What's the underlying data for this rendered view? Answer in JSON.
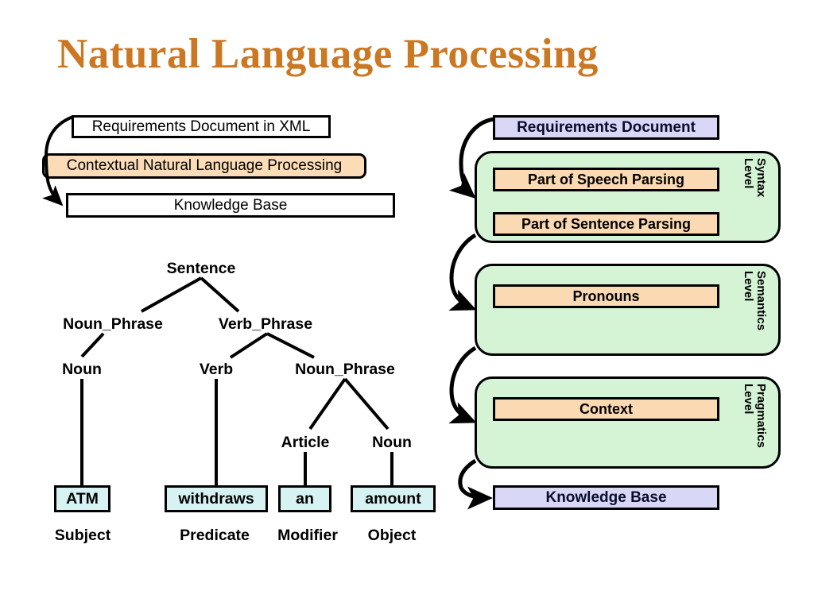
{
  "slide": {
    "title": "Natural Language Processing",
    "title_color": "#CC7722",
    "background": "#FFFFFF"
  },
  "left_flow": {
    "boxes": [
      {
        "label": "Requirements Document in XML",
        "fill": "#FFFFFF",
        "shape": "rect"
      },
      {
        "label": "Contextual Natural Language Processing",
        "fill": "#FBDCB6",
        "shape": "rounded"
      },
      {
        "label": "Knowledge Base",
        "fill": "#FFFFFF",
        "shape": "rect"
      }
    ]
  },
  "parse_tree": {
    "nodes": [
      {
        "label": "Sentence"
      },
      {
        "label": "Noun_Phrase"
      },
      {
        "label": "Verb_Phrase"
      },
      {
        "label": "Noun"
      },
      {
        "label": "Verb"
      },
      {
        "label": "Noun_Phrase"
      },
      {
        "label": "Article"
      },
      {
        "label": "Noun"
      }
    ],
    "leaves": [
      {
        "word": "ATM",
        "role": "Subject",
        "fill": "#D6F2F2"
      },
      {
        "word": "withdraws",
        "role": "Predicate",
        "fill": "#D6F2F2"
      },
      {
        "word": "an",
        "role": "Modifier",
        "fill": "#D6F2F2"
      },
      {
        "word": "amount",
        "role": "Object",
        "fill": "#D6F2F2"
      }
    ]
  },
  "pipeline": {
    "input": {
      "label": "Requirements Document",
      "fill": "#D8D8F6"
    },
    "output": {
      "label": "Knowledge Base",
      "fill": "#D8D8F6"
    },
    "levels": [
      {
        "level_line1": "Syntax",
        "level_line2": "Level",
        "fill": "#D5F4D5",
        "items": [
          {
            "label": "Part of Speech Parsing",
            "fill": "#FBD9B2"
          },
          {
            "label": "Part of Sentence Parsing",
            "fill": "#FBD9B2"
          }
        ]
      },
      {
        "level_line1": "Semantics",
        "level_line2": "Level",
        "fill": "#D5F4D5",
        "items": [
          {
            "label": "Pronouns",
            "fill": "#FBD9B2"
          }
        ]
      },
      {
        "level_line1": "Pragmatics",
        "level_line2": "Level",
        "fill": "#D5F4D5",
        "items": [
          {
            "label": "Context",
            "fill": "#FBD9B2"
          }
        ]
      }
    ]
  }
}
